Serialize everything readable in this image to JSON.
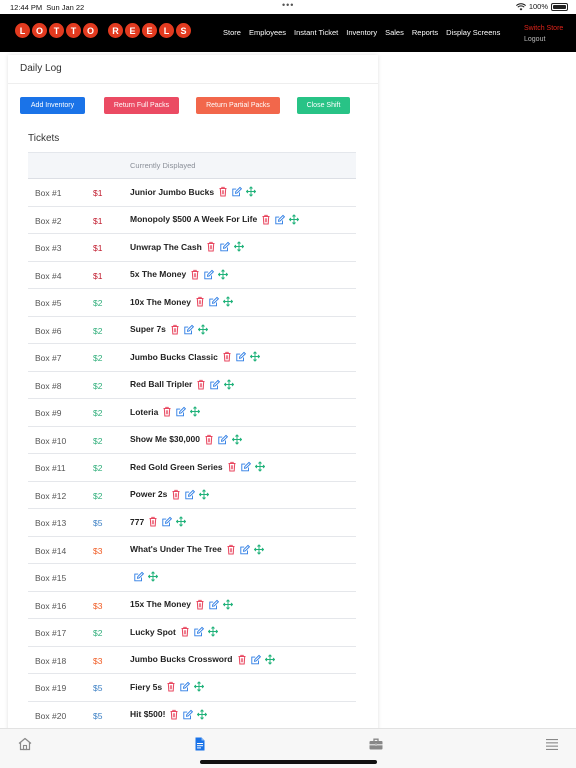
{
  "status": {
    "time": "12:44 PM",
    "date": "Sun Jan 22",
    "battery": "100%"
  },
  "nav": {
    "brand_letters": [
      "L",
      "O",
      "T",
      "T",
      "O",
      "",
      "R",
      "E",
      "E",
      "L",
      "S"
    ],
    "links": [
      "Store",
      "Employees",
      "Instant Ticket",
      "Inventory",
      "Sales",
      "Reports",
      "Display Screens"
    ],
    "switch_store": "Switch Store",
    "logout": "Logout"
  },
  "page": {
    "title": "Daily Log",
    "buttons": {
      "add_inventory": "Add Inventory",
      "return_full": "Return Full Packs",
      "return_partial": "Return Partial Packs",
      "close_shift": "Close Shift"
    },
    "section_title": "Tickets",
    "table_header": {
      "displayed": "Currently Displayed"
    }
  },
  "colors": {
    "brand": "#e23a1f",
    "price_1": "#c0182b",
    "price_2": "#2fae7a",
    "price_3": "#f05a22",
    "price_5": "#3b7fc4",
    "delete_icon": "#e8455e",
    "edit_icon": "#2a7be4",
    "move_icon": "#20b27a",
    "tab_active": "#1a73e8"
  },
  "tickets": [
    {
      "box": "Box #1",
      "price": "$1",
      "name": "Junior Jumbo Bucks",
      "deletable": true
    },
    {
      "box": "Box #2",
      "price": "$1",
      "name": "Monopoly $500 A Week For Life",
      "deletable": true
    },
    {
      "box": "Box #3",
      "price": "$1",
      "name": "Unwrap The Cash",
      "deletable": true
    },
    {
      "box": "Box #4",
      "price": "$1",
      "name": "5x The Money",
      "deletable": true
    },
    {
      "box": "Box #5",
      "price": "$2",
      "name": "10x The Money",
      "deletable": true
    },
    {
      "box": "Box #6",
      "price": "$2",
      "name": "Super 7s",
      "deletable": true
    },
    {
      "box": "Box #7",
      "price": "$2",
      "name": "Jumbo Bucks Classic",
      "deletable": true
    },
    {
      "box": "Box #8",
      "price": "$2",
      "name": "Red Ball Tripler",
      "deletable": true
    },
    {
      "box": "Box #9",
      "price": "$2",
      "name": "Loteria",
      "deletable": true
    },
    {
      "box": "Box #10",
      "price": "$2",
      "name": "Show Me $30,000",
      "deletable": true
    },
    {
      "box": "Box #11",
      "price": "$2",
      "name": "Red Gold Green Series",
      "deletable": true
    },
    {
      "box": "Box #12",
      "price": "$2",
      "name": "Power 2s",
      "deletable": true
    },
    {
      "box": "Box #13",
      "price": "$5",
      "name": "777",
      "deletable": true
    },
    {
      "box": "Box #14",
      "price": "$3",
      "name": "What's Under The Tree",
      "deletable": true
    },
    {
      "box": "Box #15",
      "price": "",
      "name": "",
      "deletable": false
    },
    {
      "box": "Box #16",
      "price": "$3",
      "name": "15x The Money",
      "deletable": true
    },
    {
      "box": "Box #17",
      "price": "$2",
      "name": "Lucky Spot",
      "deletable": true
    },
    {
      "box": "Box #18",
      "price": "$3",
      "name": "Jumbo Bucks Crossword",
      "deletable": true
    },
    {
      "box": "Box #19",
      "price": "$5",
      "name": "Fiery 5s",
      "deletable": true
    },
    {
      "box": "Box #20",
      "price": "$5",
      "name": "Hit $500!",
      "deletable": true
    }
  ],
  "tabs": [
    {
      "icon": "home-icon",
      "active": false
    },
    {
      "icon": "document-icon",
      "active": true
    },
    {
      "icon": "briefcase-icon",
      "active": false
    },
    {
      "icon": "menu-icon",
      "active": false
    }
  ]
}
